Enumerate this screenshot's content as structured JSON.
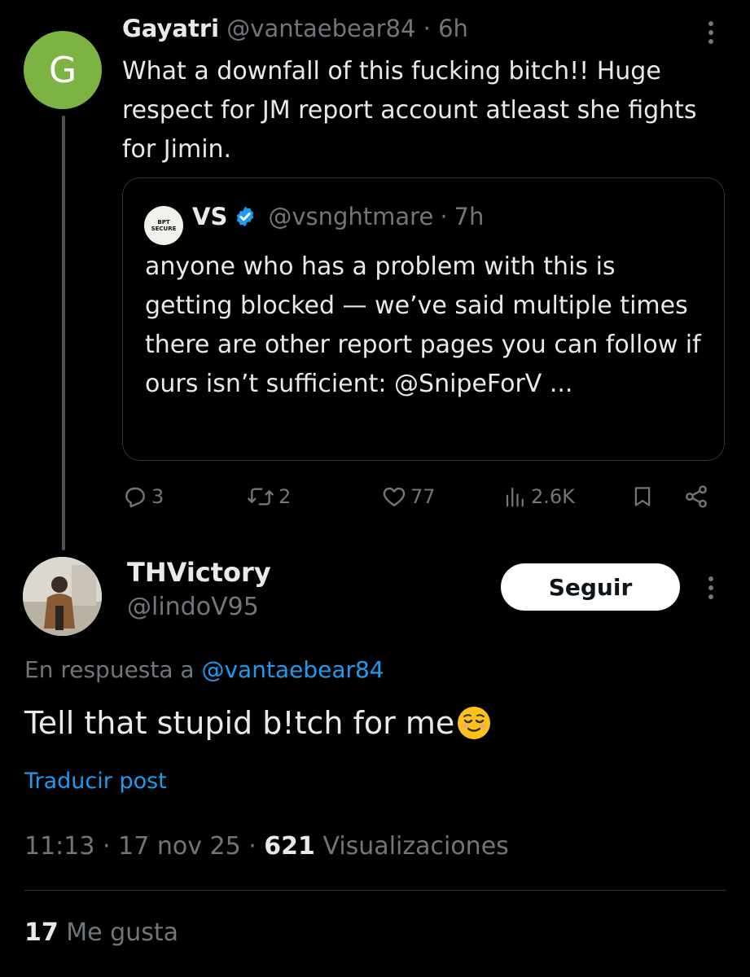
{
  "parent_tweet": {
    "avatar_letter": "G",
    "name": "Gayatri",
    "handle": "@vantaebear84",
    "separator": "·",
    "time": "6h",
    "text": "What a downfall of this fucking bitch!! Huge respect for JM report account atleast she fights for Jimin.",
    "quote": {
      "avatar_text": "BPT SECURE",
      "name": "VS",
      "handle": "@vsnghtmare",
      "separator": "·",
      "time": "7h",
      "text": "anyone who has a problem with this is getting blocked — we’ve said multiple times there are other report pages you can follow if ours isn’t sufficient: @SnipeForV ..."
    },
    "actions": {
      "replies": "3",
      "reposts": "2",
      "likes": "77",
      "views": "2.6K"
    }
  },
  "main_tweet": {
    "name": "THVictory",
    "handle": "@lindoV95",
    "follow_label": "Seguir",
    "reply_prefix": "En respuesta a",
    "reply_handle": "@vantaebear84",
    "text": "Tell that stupid b!tch for me",
    "emoji": "relieved-face",
    "translate_label": "Traducir post",
    "time": "11:13",
    "sep1": "·",
    "date": "17 nov 25",
    "sep2": "·",
    "views_count": "621",
    "views_label": "Visualizaciones",
    "likes_count": "17",
    "likes_label": "Me gusta"
  },
  "colors": {
    "background": "#000000",
    "text": "#e7e9ea",
    "secondary": "#71767b",
    "accent": "#1d9bf0",
    "avatar_g": "#7cb342",
    "border": "#2f3336"
  }
}
